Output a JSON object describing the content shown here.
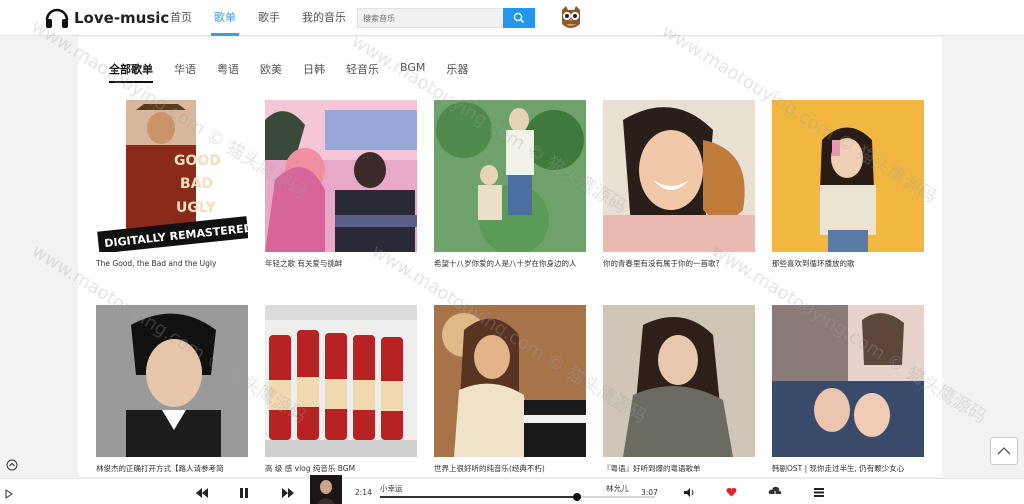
{
  "header": {
    "logo_text": "Love-music",
    "nav": [
      {
        "label": "首页",
        "active": false
      },
      {
        "label": "歌单",
        "active": true
      },
      {
        "label": "歌手",
        "active": false
      },
      {
        "label": "我的音乐",
        "active": false
      }
    ],
    "search_placeholder": "搜索音乐",
    "accent": "#3d9be9"
  },
  "categories": [
    {
      "label": "全部歌单",
      "active": true
    },
    {
      "label": "华语",
      "active": false
    },
    {
      "label": "粤语",
      "active": false
    },
    {
      "label": "欧美",
      "active": false
    },
    {
      "label": "日韩",
      "active": false
    },
    {
      "label": "轻音乐",
      "active": false
    },
    {
      "label": "BGM",
      "active": false
    },
    {
      "label": "乐器",
      "active": false
    }
  ],
  "playlists": [
    {
      "title": "The Good, the Bad and the Ugly",
      "cover_text": "DIGITALLY REMASTERED"
    },
    {
      "title": "年轻之歌 有关爱与挑衅"
    },
    {
      "title": "希望十八岁你爱的人是八十岁在你身边的人"
    },
    {
      "title": "你的青春里有没有属于你的一首歌?"
    },
    {
      "title": "那些喜欢到循环播放的歌"
    },
    {
      "title": "林俊杰的正确打开方式【路人请参考简"
    },
    {
      "title": "高 级 感 vlog 纯音乐 BGM"
    },
    {
      "title": "世界上很好听的纯音乐(经典不朽)"
    },
    {
      "title": "『粤语』好听到爆的粤语歌单"
    },
    {
      "title": "韩剧OST | 现你走过半生, 仍有颗少女心"
    }
  ],
  "player": {
    "current_time": "2:14",
    "total_time": "3:07",
    "song_title": "小幸运",
    "artist": "林允儿",
    "progress": 0.716
  },
  "watermark_text": "www.maotouying.com © 猫头鹰源码"
}
